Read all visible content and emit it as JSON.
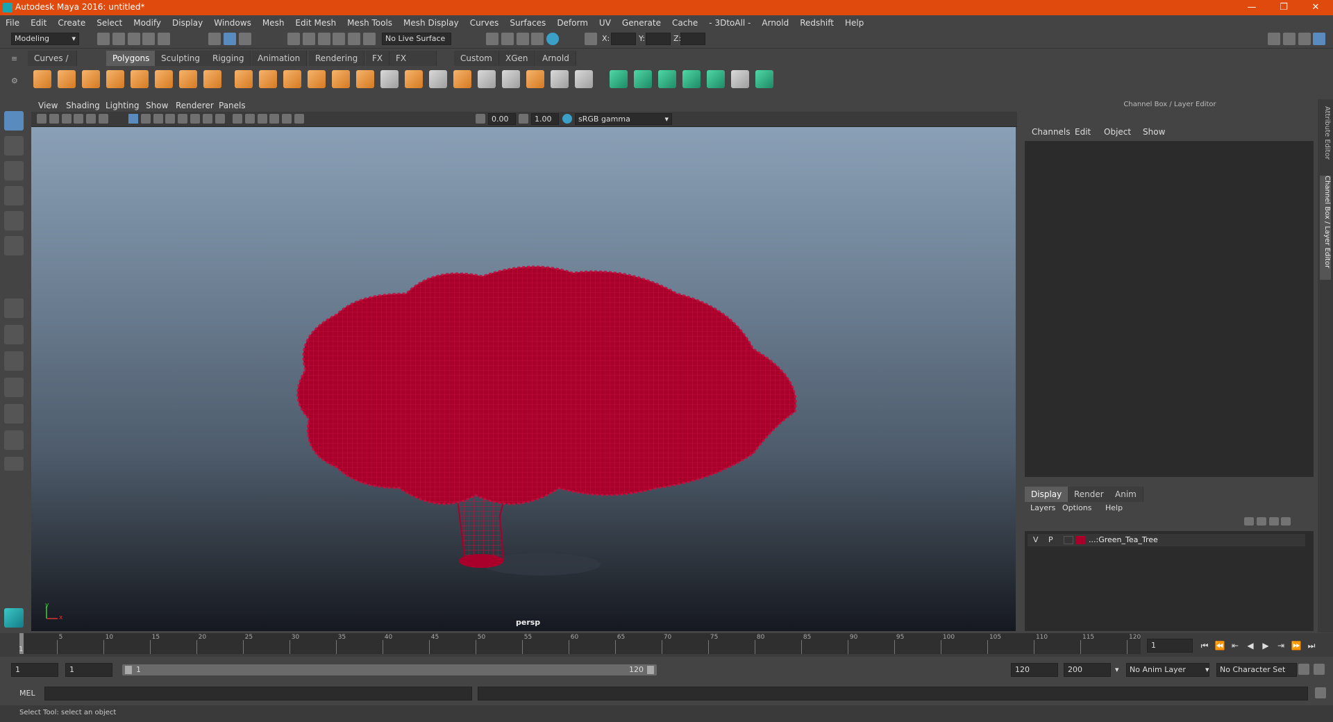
{
  "window": {
    "title": "Autodesk Maya 2016: untitled*",
    "controls": [
      "—",
      "❐",
      "✕"
    ]
  },
  "menu": [
    "File",
    "Edit",
    "Create",
    "Select",
    "Modify",
    "Display",
    "Windows",
    "Mesh",
    "Edit Mesh",
    "Mesh Tools",
    "Mesh Display",
    "Curves",
    "Surfaces",
    "Deform",
    "UV",
    "Generate",
    "Cache",
    "- 3DtoAll -",
    "Arnold",
    "Redshift",
    "Help"
  ],
  "status": {
    "mode": "Modeling",
    "live_surface": "No Live Surface",
    "x_label": "X:",
    "y_label": "Y:",
    "z_label": "Z:"
  },
  "shelf_tabs": [
    "Curves / Surfaces",
    "Polygons",
    "Sculpting",
    "Rigging",
    "Animation",
    "Rendering",
    "FX",
    "FX Caching",
    "Custom",
    "XGen",
    "Arnold"
  ],
  "shelf_active": "Polygons",
  "viewport": {
    "menu": [
      "View",
      "Shading",
      "Lighting",
      "Show",
      "Renderer",
      "Panels"
    ],
    "exposure": "0.00",
    "gamma": "1.00",
    "colorspace": "sRGB gamma",
    "camera": "persp",
    "axis_x": "x",
    "axis_y": "y"
  },
  "channel_box": {
    "title": "Channel Box / Layer Editor",
    "menu": [
      "Channels",
      "Edit",
      "Object",
      "Show"
    ],
    "tabs": [
      "Display",
      "Render",
      "Anim"
    ],
    "layer_menu": [
      "Layers",
      "Options",
      "Help"
    ],
    "layer": {
      "v": "V",
      "p": "P",
      "name": "...:Green_Tea_Tree",
      "color": "#a8002a"
    }
  },
  "side_tabs": [
    "Attribute Editor",
    "Channel Box / Layer Editor"
  ],
  "timeline": {
    "ticks": [
      "5",
      "10",
      "15",
      "20",
      "25",
      "30",
      "35",
      "40",
      "45",
      "50",
      "55",
      "60",
      "65",
      "70",
      "75",
      "80",
      "85",
      "90",
      "95",
      "100",
      "105",
      "110",
      "115",
      "120"
    ],
    "start_label": "1",
    "current_frame": "1"
  },
  "range": {
    "start": "1",
    "anim_start": "1",
    "slider_start": "1",
    "slider_end": "120",
    "end": "120",
    "anim_end": "200",
    "anim_layer": "No Anim Layer",
    "char_set": "No Character Set"
  },
  "cmd": {
    "label": "MEL"
  },
  "help": {
    "text": "Select Tool: select an object"
  },
  "colors": {
    "title": "#e04a0c",
    "tree": "#a8002a"
  }
}
